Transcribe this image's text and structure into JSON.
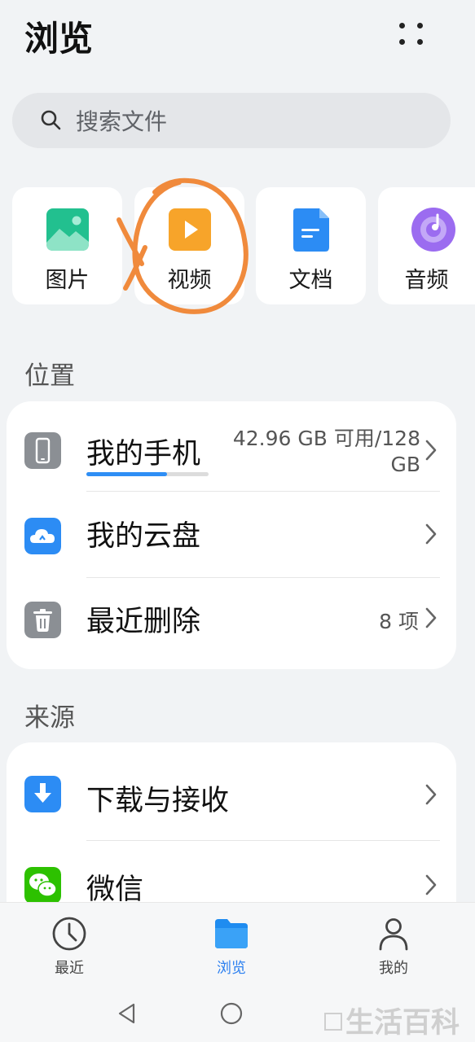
{
  "header": {
    "title": "浏览",
    "more_icon": "more-dots-icon"
  },
  "search": {
    "placeholder": "搜索文件",
    "icon": "search-icon"
  },
  "categories": [
    {
      "label": "图片",
      "icon": "image-icon",
      "color": "#1fbf8f"
    },
    {
      "label": "视频",
      "icon": "video-play-icon",
      "color": "#f7a42a"
    },
    {
      "label": "文档",
      "icon": "document-icon",
      "color": "#2c8cf4"
    },
    {
      "label": "音频",
      "icon": "audio-disc-icon",
      "color": "#9b6cf0"
    }
  ],
  "locations": {
    "section_title": "位置",
    "items": [
      {
        "name": "我的手机",
        "info": "42.96 GB 可用/128\nGB",
        "icon": "phone-icon",
        "storage_used_fraction": 0.66
      },
      {
        "name": "我的云盘",
        "info": "",
        "icon": "cloud-icon"
      },
      {
        "name": "最近删除",
        "info": "8 项",
        "icon": "trash-icon"
      }
    ]
  },
  "sources": {
    "section_title": "来源",
    "items": [
      {
        "name": "下载与接收",
        "icon": "download-icon"
      },
      {
        "name": "微信",
        "icon": "wechat-icon"
      }
    ]
  },
  "tabbar": [
    {
      "label": "最近",
      "icon": "clock-icon",
      "active": false
    },
    {
      "label": "浏览",
      "icon": "folder-icon",
      "active": true
    },
    {
      "label": "我的",
      "icon": "person-icon",
      "active": false
    }
  ],
  "colors": {
    "accent": "#2b7ff0",
    "annotation": "#f08a3c"
  },
  "watermark": "生活百科"
}
